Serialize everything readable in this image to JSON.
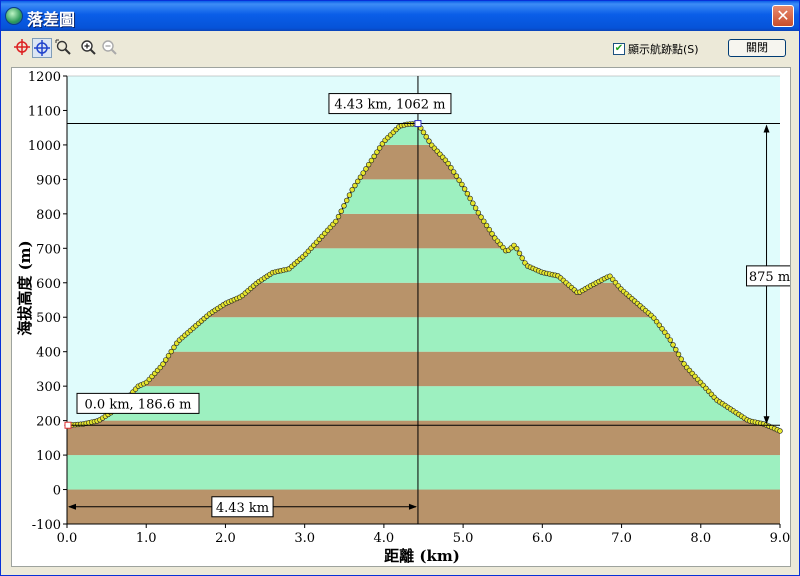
{
  "window": {
    "title": "落差圖",
    "close_glyph": "✕"
  },
  "toolbar": {
    "tools": [
      {
        "name": "crosshair-red-icon"
      },
      {
        "name": "crosshair-blue-icon"
      },
      {
        "name": "zoom-reset-icon"
      },
      {
        "name": "zoom-in-icon"
      },
      {
        "name": "zoom-out-icon"
      }
    ],
    "show_points_label": "顯示航跡點(S)",
    "show_points_checked": true,
    "close_label": "關閉"
  },
  "chart_data": {
    "type": "area",
    "title": "",
    "xlabel": "距離  (km)",
    "ylabel": "海拔高度 (m)",
    "xlim": [
      0,
      9.0
    ],
    "ylim": [
      -100,
      1200
    ],
    "xticks": [
      "0.0",
      "1.0",
      "2.0",
      "3.0",
      "4.0",
      "5.0",
      "6.0",
      "7.0",
      "8.0",
      "9.0"
    ],
    "yticks": [
      "-100",
      "0",
      "100",
      "200",
      "300",
      "400",
      "500",
      "600",
      "700",
      "800",
      "900",
      "1000",
      "1100",
      "1200"
    ],
    "band_colors": [
      "#b8936a",
      "#9df0c0"
    ],
    "background": "#e0fcfc",
    "marker_color": "#e6e62e",
    "line_color": "#000000",
    "x": [
      0.0,
      0.2,
      0.4,
      0.6,
      0.7,
      0.9,
      1.0,
      1.2,
      1.4,
      1.6,
      1.8,
      2.0,
      2.2,
      2.4,
      2.6,
      2.8,
      3.0,
      3.2,
      3.4,
      3.6,
      3.8,
      4.0,
      4.2,
      4.3,
      4.43,
      4.6,
      4.8,
      5.0,
      5.2,
      5.4,
      5.55,
      5.65,
      5.8,
      6.0,
      6.2,
      6.45,
      6.6,
      6.85,
      7.0,
      7.2,
      7.4,
      7.6,
      7.8,
      8.0,
      8.2,
      8.4,
      8.6,
      8.8,
      9.0
    ],
    "y": [
      186.6,
      190,
      200,
      230,
      250,
      300,
      310,
      360,
      430,
      470,
      510,
      540,
      560,
      600,
      630,
      640,
      680,
      730,
      780,
      870,
      940,
      1010,
      1055,
      1060,
      1062,
      1000,
      950,
      880,
      800,
      730,
      690,
      710,
      650,
      630,
      620,
      570,
      590,
      620,
      580,
      540,
      500,
      440,
      360,
      310,
      260,
      230,
      200,
      190,
      170
    ],
    "cursor": {
      "x": 4.43,
      "label": "4.43 km, 1062 m"
    },
    "start_label": "0.0 km, 186.6 m",
    "distance_label": "4.43 km",
    "elevation_gain_label": "875 m"
  }
}
